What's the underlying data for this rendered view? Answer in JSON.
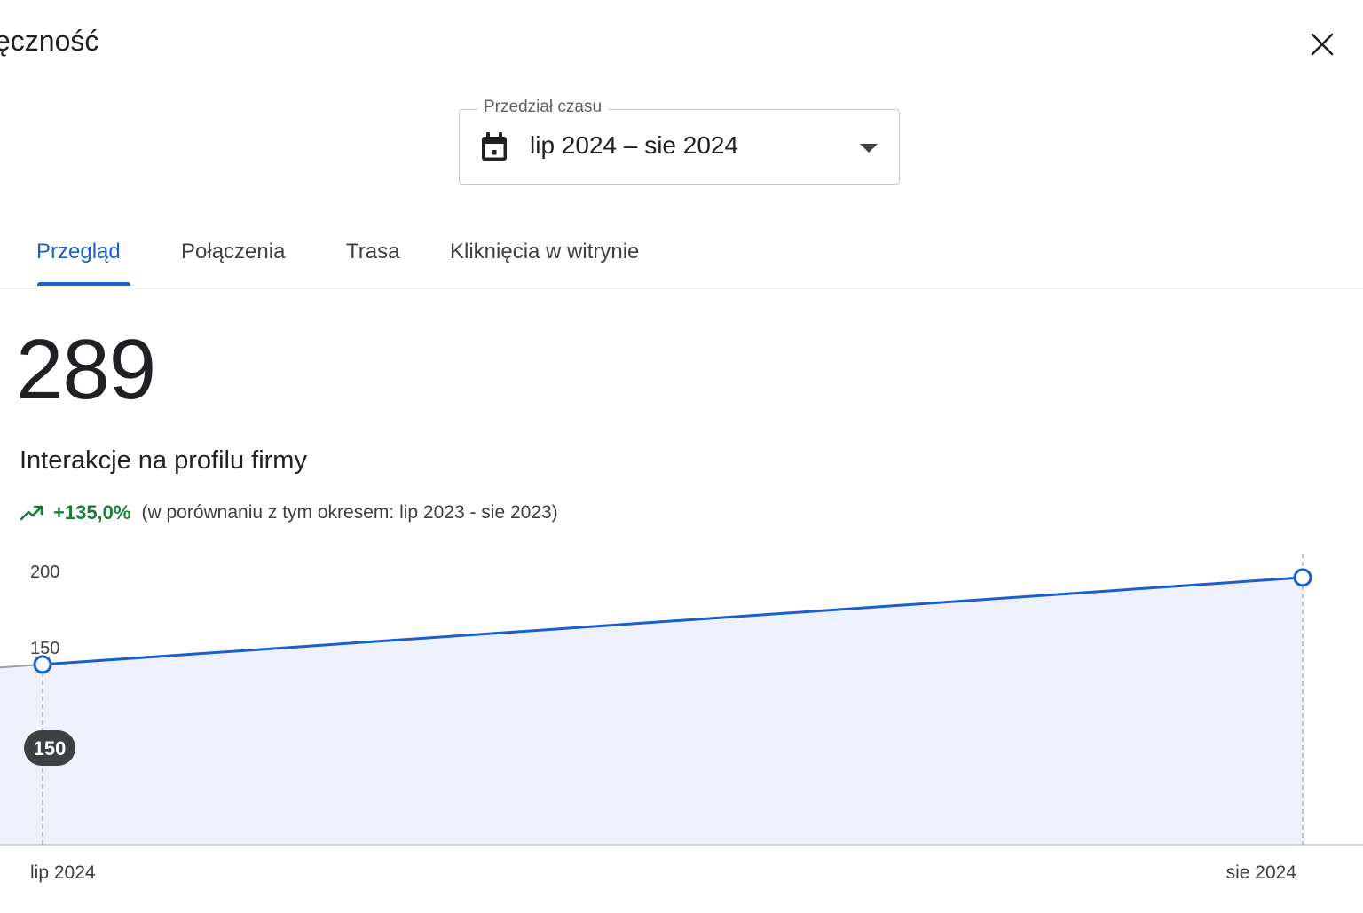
{
  "window": {
    "title": "ęczność"
  },
  "close_icon": "close-icon",
  "range_picker": {
    "label": "Przedział czasu",
    "value": "lip 2024 – sie 2024",
    "icon": "calendar-icon"
  },
  "tabs": [
    {
      "label": "Przegląd",
      "active": true
    },
    {
      "label": "Połączenia",
      "active": false
    },
    {
      "label": "Trasa",
      "active": false
    },
    {
      "label": "Kliknięcia w witrynie",
      "active": false
    }
  ],
  "metric": {
    "total": "289",
    "title": "Interakcje na profilu firmy",
    "change": "+135,0%",
    "comparison": "(w porównaniu z tym okresem: lip 2023 - sie 2023)"
  },
  "colors": {
    "accent": "#1a5fcc",
    "positive": "#188038",
    "area_fill": "#eef1fb",
    "tooltip": "#3c4043"
  },
  "chart_data": {
    "type": "area",
    "x": [
      "lip 2024",
      "sie 2024"
    ],
    "series": [
      {
        "values": [
          139,
          196
        ]
      }
    ],
    "y_ticks": [
      "200",
      "150"
    ],
    "tooltip": {
      "x": "lip 2024",
      "label": "150"
    },
    "grid": false
  }
}
